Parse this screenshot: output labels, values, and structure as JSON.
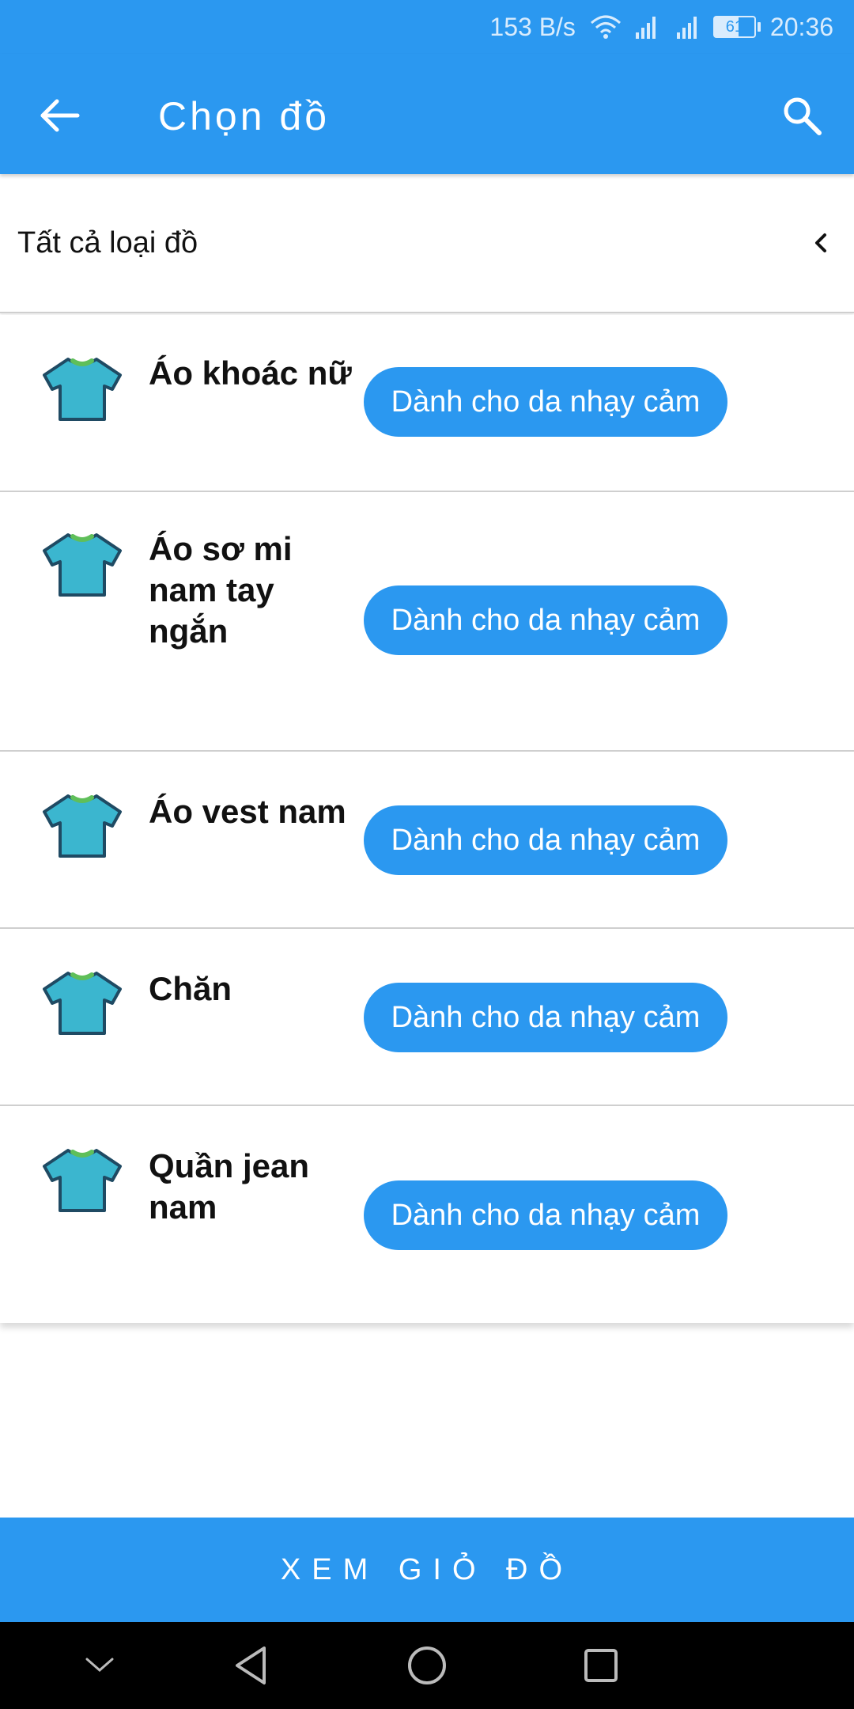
{
  "status_bar": {
    "speed": "153 B/s",
    "battery": "61",
    "time": "20:36"
  },
  "app_bar": {
    "title": "Chọn đồ",
    "back_icon": "arrow-left-icon",
    "search_icon": "search-icon"
  },
  "filter": {
    "label": "Tất cả loại đồ",
    "icon": "chevron-left-icon"
  },
  "items": [
    {
      "name": "Áo khoác nữ",
      "tag": "Dành cho da nhạy cảm"
    },
    {
      "name": "Áo sơ mi nam tay ngắn",
      "tag": "Dành cho da nhạy cảm"
    },
    {
      "name": "Áo vest nam",
      "tag": "Dành cho da nhạy cảm"
    },
    {
      "name": "Chăn",
      "tag": "Dành cho da nhạy cảm"
    },
    {
      "name": "Quần jean nam",
      "tag": "Dành cho da nhạy cảm"
    }
  ],
  "bottom_button": {
    "label": "XEM GIỎ ĐỒ"
  },
  "colors": {
    "primary": "#2b98f0",
    "shirt": "#3bb6cf",
    "shirt_outline": "#1f4a63",
    "collar": "#5fbf5a"
  }
}
